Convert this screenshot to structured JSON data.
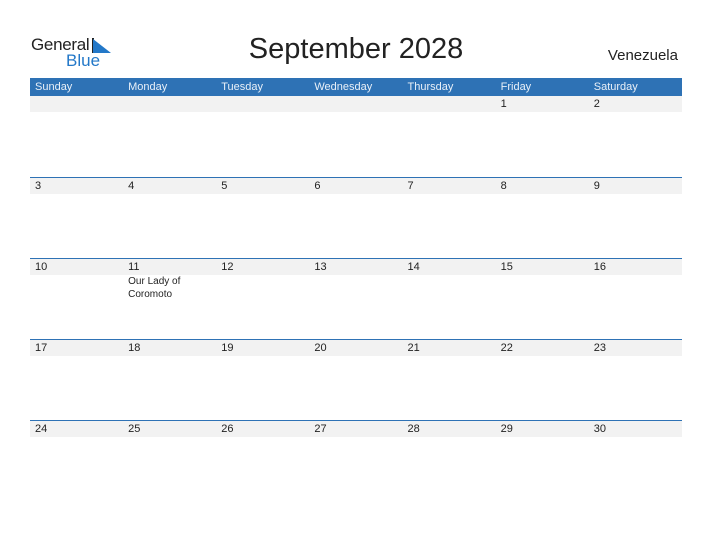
{
  "logo": {
    "word1": "General",
    "word2": "Blue"
  },
  "title": "September 2028",
  "country": "Venezuela",
  "weekdays": [
    "Sunday",
    "Monday",
    "Tuesday",
    "Wednesday",
    "Thursday",
    "Friday",
    "Saturday"
  ],
  "weeks": [
    [
      {
        "day": ""
      },
      {
        "day": ""
      },
      {
        "day": ""
      },
      {
        "day": ""
      },
      {
        "day": ""
      },
      {
        "day": "1"
      },
      {
        "day": "2"
      }
    ],
    [
      {
        "day": "3"
      },
      {
        "day": "4"
      },
      {
        "day": "5"
      },
      {
        "day": "6"
      },
      {
        "day": "7"
      },
      {
        "day": "8"
      },
      {
        "day": "9"
      }
    ],
    [
      {
        "day": "10"
      },
      {
        "day": "11",
        "event": "Our Lady of Coromoto"
      },
      {
        "day": "12"
      },
      {
        "day": "13"
      },
      {
        "day": "14"
      },
      {
        "day": "15"
      },
      {
        "day": "16"
      }
    ],
    [
      {
        "day": "17"
      },
      {
        "day": "18"
      },
      {
        "day": "19"
      },
      {
        "day": "20"
      },
      {
        "day": "21"
      },
      {
        "day": "22"
      },
      {
        "day": "23"
      }
    ],
    [
      {
        "day": "24"
      },
      {
        "day": "25"
      },
      {
        "day": "26"
      },
      {
        "day": "27"
      },
      {
        "day": "28"
      },
      {
        "day": "29"
      },
      {
        "day": "30"
      }
    ]
  ],
  "colors": {
    "header": "#2e72b5",
    "stripe": "#f2f2f2",
    "brand_blue": "#2378c8"
  }
}
